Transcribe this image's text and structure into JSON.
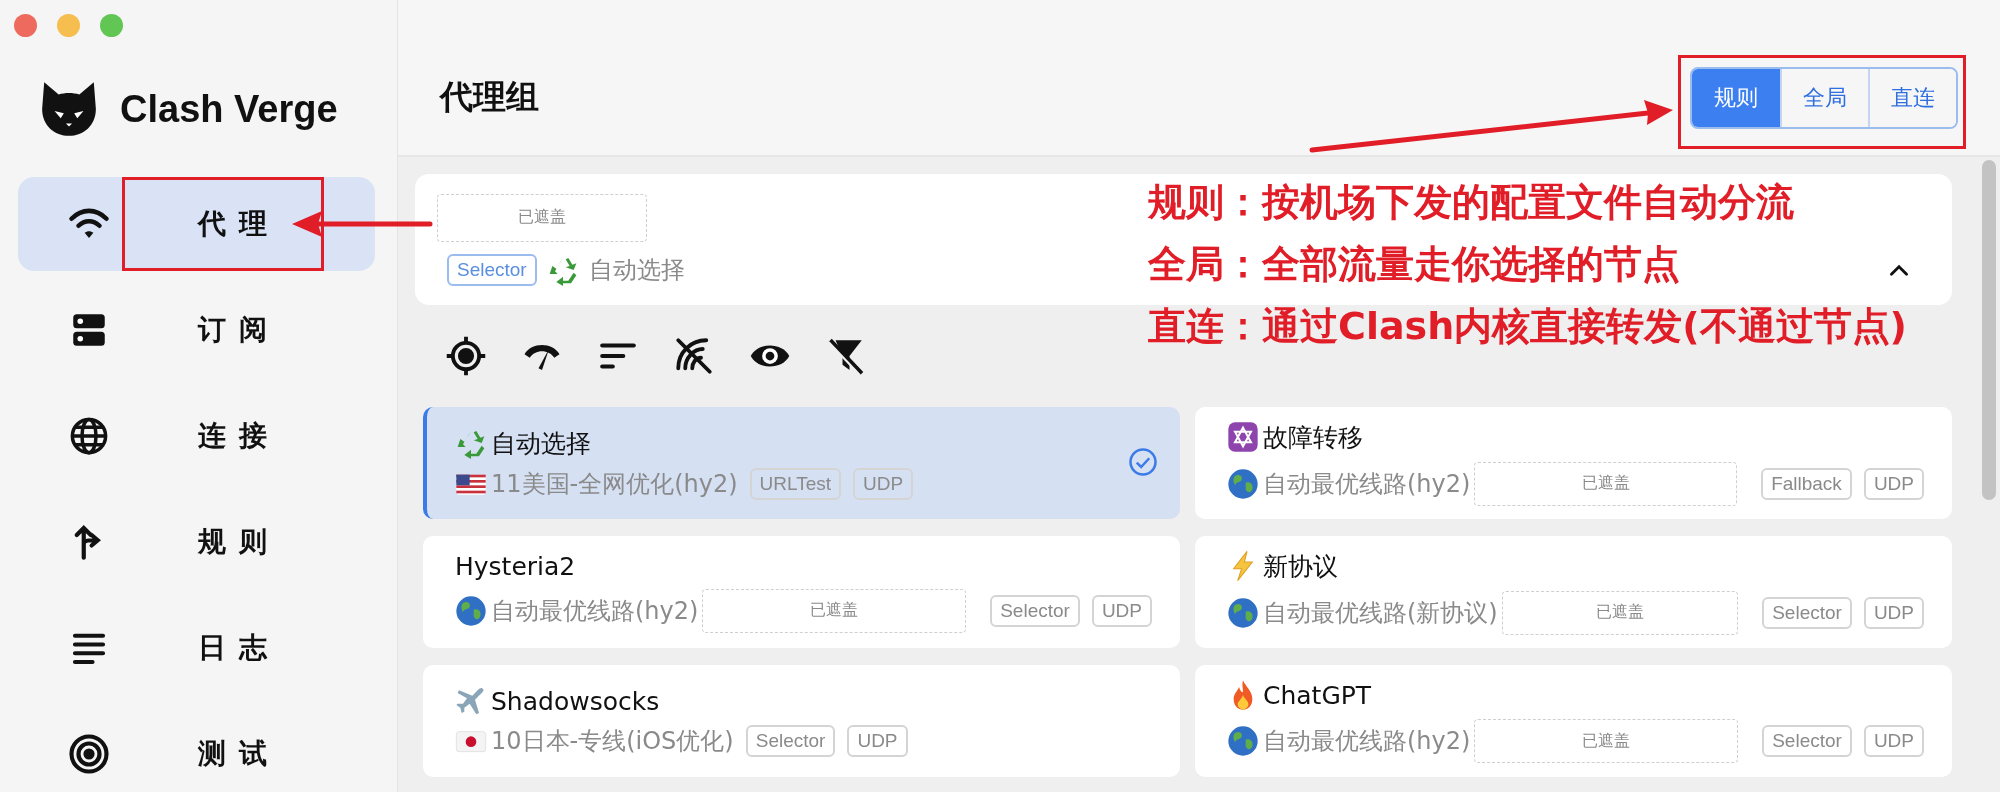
{
  "sidebar": {
    "logo_text": "Clash Verge",
    "items": [
      {
        "label": "代理",
        "selected": true
      },
      {
        "label": "订阅",
        "selected": false
      },
      {
        "label": "连接",
        "selected": false
      },
      {
        "label": "规则",
        "selected": false
      },
      {
        "label": "日志",
        "selected": false
      },
      {
        "label": "测试",
        "selected": false
      }
    ]
  },
  "header": {
    "title": "代理组",
    "modes": [
      {
        "label": "规则",
        "selected": true
      },
      {
        "label": "全局",
        "selected": false
      },
      {
        "label": "直连",
        "selected": false
      }
    ]
  },
  "group_card": {
    "mask": "已遮盖",
    "type": "Selector",
    "current": "自动选择",
    "expanded": true
  },
  "proxies": [
    {
      "name": "自动选择",
      "current": "11美国-全网优化(hy2)",
      "type": "URLTest",
      "udp": "UDP",
      "selected": true
    },
    {
      "name": "故障转移",
      "current": "自动最优线路(hy2)",
      "mask": "已遮盖",
      "type": "Fallback",
      "udp": "UDP",
      "selected": false
    },
    {
      "name": "Hysteria2",
      "current": "自动最优线路(hy2)",
      "mask": "已遮盖",
      "type": "Selector",
      "udp": "UDP",
      "selected": false
    },
    {
      "name": "新协议",
      "current": "自动最优线路(新协议)",
      "mask": "已遮盖",
      "type": "Selector",
      "udp": "UDP",
      "selected": false
    },
    {
      "name": "Shadowsocks",
      "current": "10日本-专线(iOS优化)",
      "type": "Selector",
      "udp": "UDP",
      "selected": false
    },
    {
      "name": "ChatGPT",
      "current": "自动最优线路(hy2)",
      "mask": "已遮盖",
      "type": "Selector",
      "udp": "UDP",
      "selected": false
    }
  ],
  "annotations": [
    "规则：按机场下发的配置文件自动分流",
    "全局：全部流量走你选择的节点",
    "直连：通过Clash内核直接转发(不通过节点)"
  ]
}
